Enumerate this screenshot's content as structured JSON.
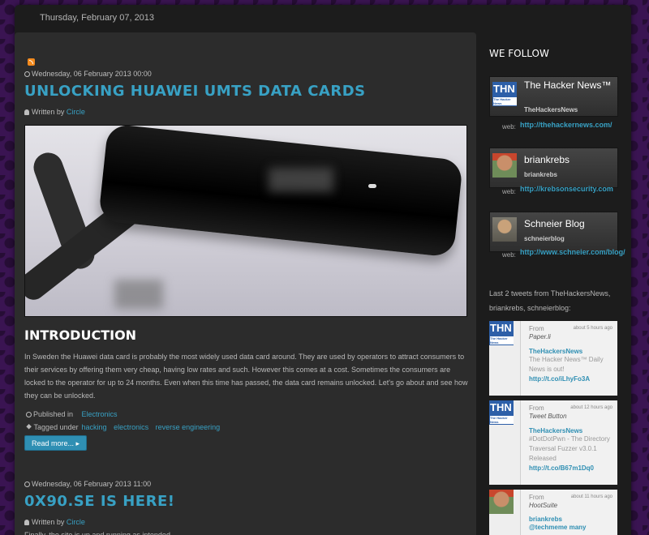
{
  "header": {
    "date": "Thursday, February 07, 2013"
  },
  "posts": [
    {
      "date": "Wednesday, 06 February 2013 00:00",
      "title": "UNLOCKING HUAWEI UMTS DATA CARDS",
      "written_by_label": "Written by",
      "author": "Circle",
      "section_title": "INTRODUCTION",
      "body": "In Sweden the Huawei data card is probably the most widely used data card around. They are used by operators to attract consumers to their services by offering them very cheap, having low rates and such. However this comes at a cost. Sometimes the consumers are locked to the operator for up to 24 months. Even when this time has passed, the data card remains unlocked. Let's go about and see how they can be unlocked.",
      "published_label": "Published in",
      "category": "Electronics",
      "tagged_label": "Tagged under",
      "tags": [
        "hacking",
        "electronics",
        "reverse engineering"
      ],
      "read_more": "Read more...  ▸"
    },
    {
      "date": "Wednesday, 06 February 2013 11:00",
      "title": "0X90.SE IS HERE!",
      "written_by_label": "Written by",
      "author": "Circle",
      "body": "Finally, the site is up and running as intended."
    }
  ],
  "sidebar": {
    "title": "WE FOLLOW",
    "web_label": "web:",
    "follows": [
      {
        "name": "The Hacker News™",
        "handle": "TheHackersNews",
        "url": "http://thehackernews.com/",
        "avatar": "thn-logo"
      },
      {
        "name": "briankrebs",
        "handle": "briankrebs",
        "url": "http://krebsonsecurity.com",
        "avatar": "briankrebs-photo"
      },
      {
        "name": "Schneier Blog",
        "handle": "schneierblog",
        "url": "http://www.schneier.com/blog/",
        "avatar": "schneier-photo"
      }
    ],
    "tweets_heading": "Last 2 tweets from TheHackersNews, briankrebs, schneierblog:",
    "tweets": [
      {
        "from": "From",
        "ago": "about 5 hours ago",
        "source": "Paper.li",
        "user": "TheHackersNews",
        "text": "The Hacker News™ Daily News is out!",
        "link": "http://t.co/iLhyFo3A"
      },
      {
        "from": "From",
        "ago": "about 12 hours ago",
        "source": "Tweet Button",
        "user": "TheHackersNews",
        "text": "#DotDotPwn - The Directory Traversal Fuzzer v3.0.1 Released",
        "link": "http://t.co/B67m1Dq0"
      },
      {
        "from": "From",
        "ago": "about 11 hours ago",
        "source": "HootSuite",
        "user": "briankrebs",
        "text": "@techmeme many",
        "link": ""
      }
    ]
  }
}
